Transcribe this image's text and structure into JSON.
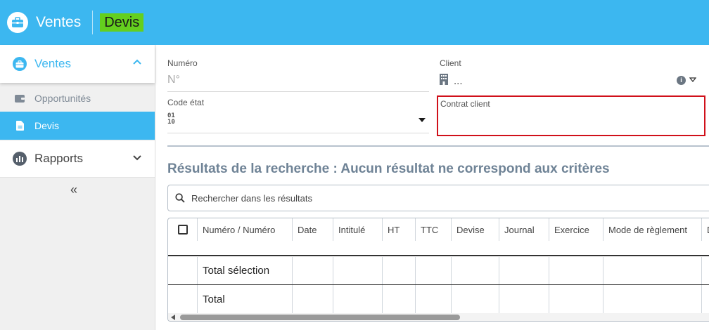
{
  "header": {
    "app_title": "Ventes",
    "module_title": "Devis",
    "module_highlight_color": "#64cf1e",
    "bar_color": "#3cb7f0"
  },
  "sidebar": {
    "ventes_label": "Ventes",
    "items": [
      {
        "label": "Opportunités",
        "icon": "wallet-icon"
      },
      {
        "label": "Devis",
        "icon": "document-icon",
        "active": true
      }
    ],
    "rapports_label": "Rapports",
    "collapse_glyph": "«"
  },
  "form": {
    "numero_label": "Numéro",
    "numero_placeholder": "N°",
    "client_label": "Client",
    "client_value": "...",
    "code_etat_label": "Code état",
    "code_etat_icon_top": "01",
    "code_etat_icon_bottom": "10",
    "contrat_label": "Contrat client",
    "info_glyph": "i"
  },
  "results": {
    "title": "Résultats de la recherche : Aucun résultat ne correspond aux critères",
    "search_placeholder": "Rechercher dans les résultats"
  },
  "table": {
    "columns": [
      "Numéro / Numéro",
      "Date",
      "Intitulé",
      "HT",
      "TTC",
      "Devise",
      "Journal",
      "Exercice",
      "Mode de règlement",
      "D"
    ],
    "total_selection_label": "Total sélection",
    "total_label": "Total"
  }
}
